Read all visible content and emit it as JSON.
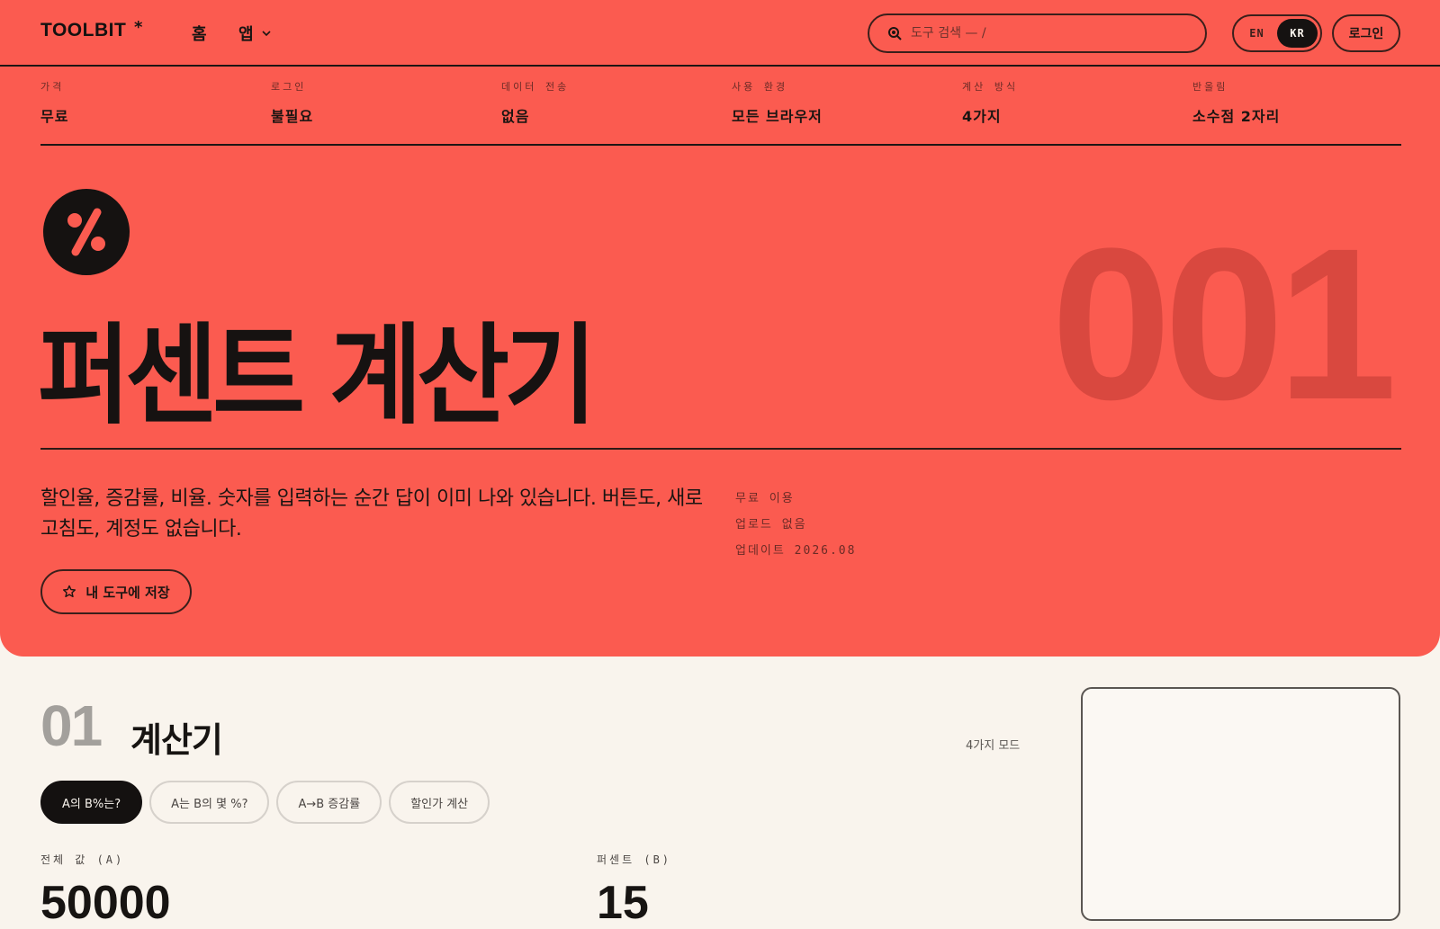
{
  "nav": {
    "logo": "TOOLBIT",
    "logo_star": "*",
    "home": "홈",
    "apps": "앱",
    "search_placeholder": "도구 검색 — /",
    "lang_en": "EN",
    "lang_kr": "KR",
    "active_lang": "KR",
    "login": "로그인"
  },
  "stats": [
    {
      "key": "가격",
      "value": "무료"
    },
    {
      "key": "로그인",
      "value": "불필요"
    },
    {
      "key": "데이터 전송",
      "value": "없음"
    },
    {
      "key": "사용 환경",
      "value": "모든 브라우저"
    },
    {
      "key": "계산 방식",
      "value": "4가지"
    },
    {
      "key": "반올림",
      "value": "소수점 2자리"
    }
  ],
  "hero": {
    "icon": "percent-icon",
    "title": "퍼센트 계산기",
    "number": "001",
    "description": "할인율, 증감률, 비율. 숫자를 입력하는 순간 답이 이미 나와 있습니다. 버튼도, 새로고침도, 계정도 없습니다.",
    "meta": [
      "무료 이용",
      "업로드 없음",
      "업데이트 2026.08"
    ],
    "save_label": "내 도구에 저장",
    "accent_color": "#fb5b50"
  },
  "calculator": {
    "section_num": "01",
    "title": "계산기",
    "modes_count": "4가지 모드",
    "tabs": [
      "A의 B%는?",
      "A는 B의 몇 %?",
      "A→B 증감률",
      "할인가 계산"
    ],
    "active_tab": 0,
    "field_a_label": "전체 값 (A)",
    "field_a_value": "50000",
    "field_b_label": "퍼센트 (B)",
    "field_b_value": "15"
  }
}
